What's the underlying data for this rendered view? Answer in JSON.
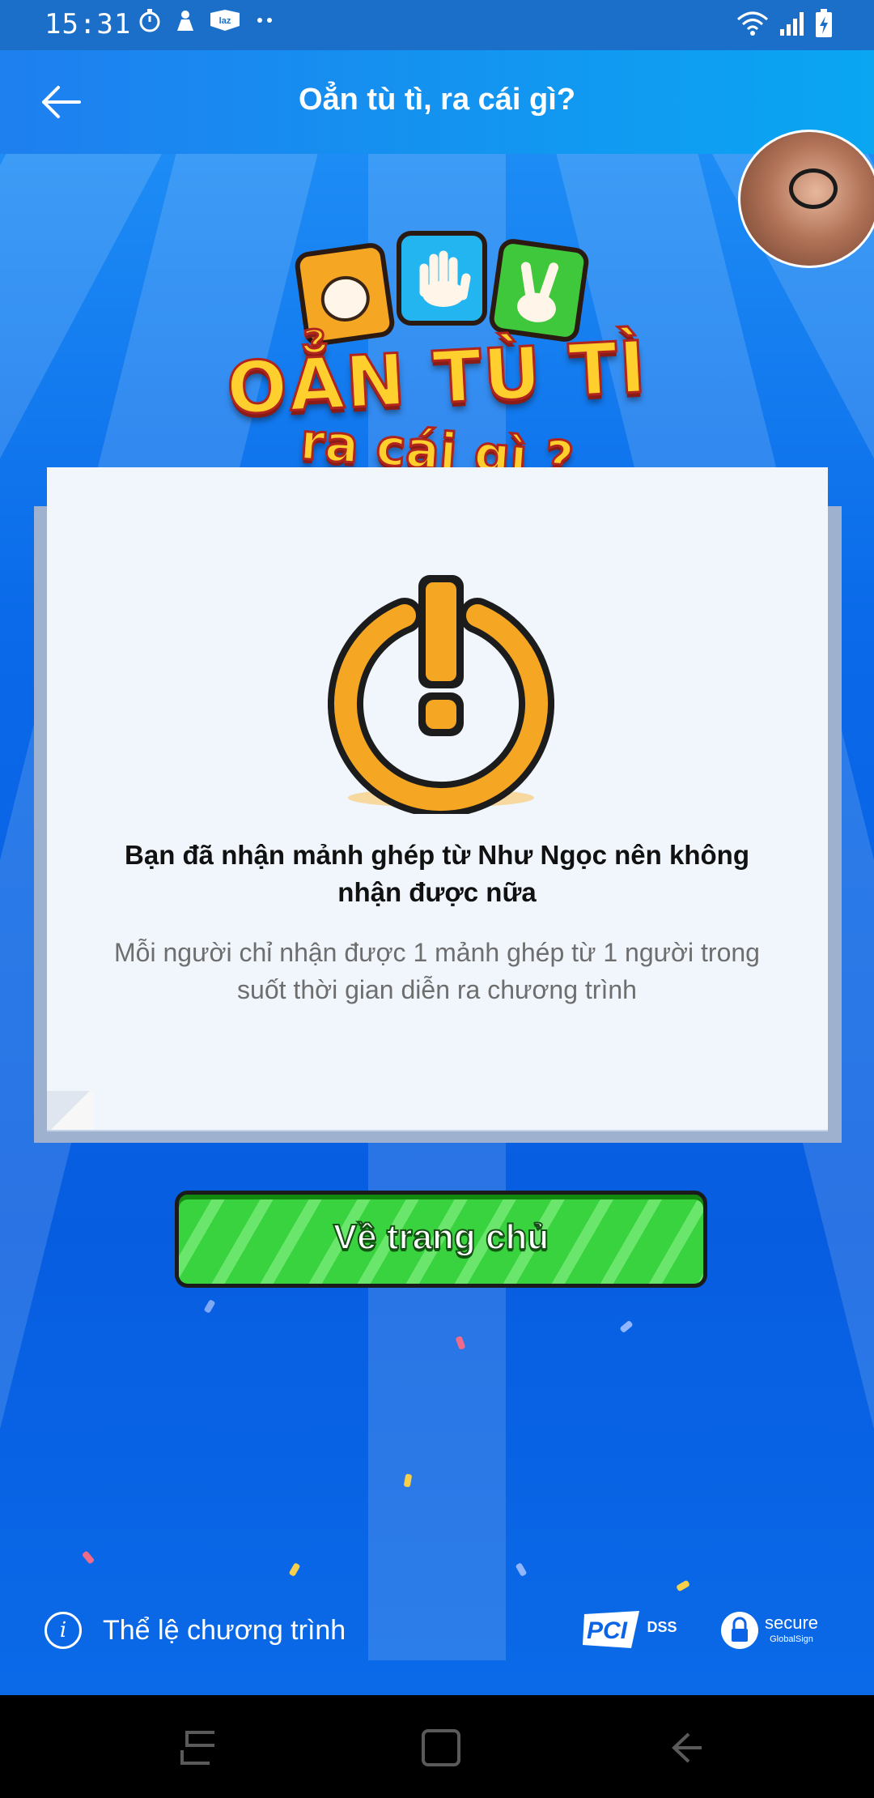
{
  "status_bar": {
    "time": "15:31",
    "left_icons": [
      "timer-icon",
      "notification-icon",
      "lazada-icon",
      "more-dots-icon"
    ],
    "right_icons": [
      "wifi-icon",
      "signal-icon",
      "battery-charging-icon"
    ]
  },
  "header": {
    "title": "Oẳn tù tì, ra cái gì?",
    "back_icon": "back-arrow-icon"
  },
  "logo": {
    "line1": "OẲN TÙ TÌ",
    "line2": "ra cái gì ?"
  },
  "dialog": {
    "title": "Bạn đã nhận mảnh ghép từ Như Ngọc nên không nhận được nữa",
    "message": "Mỗi người chỉ nhận được 1 mảnh ghép từ 1 người trong suốt thời gian diễn ra chương trình",
    "icon": "warning-power-icon"
  },
  "primary_button": {
    "label": "Về trang chủ"
  },
  "footer": {
    "rules_label": "Thể lệ chương trình",
    "pci_text": "PCI",
    "pci_sub": "DSS",
    "secure_text": "secure",
    "secure_sub": "GlobalSign"
  },
  "colors": {
    "header_start": "#1e7fef",
    "header_end": "#0aa6f2",
    "background": "#0b63e6",
    "button_green": "#39d33f",
    "warning_orange": "#f5a623"
  }
}
